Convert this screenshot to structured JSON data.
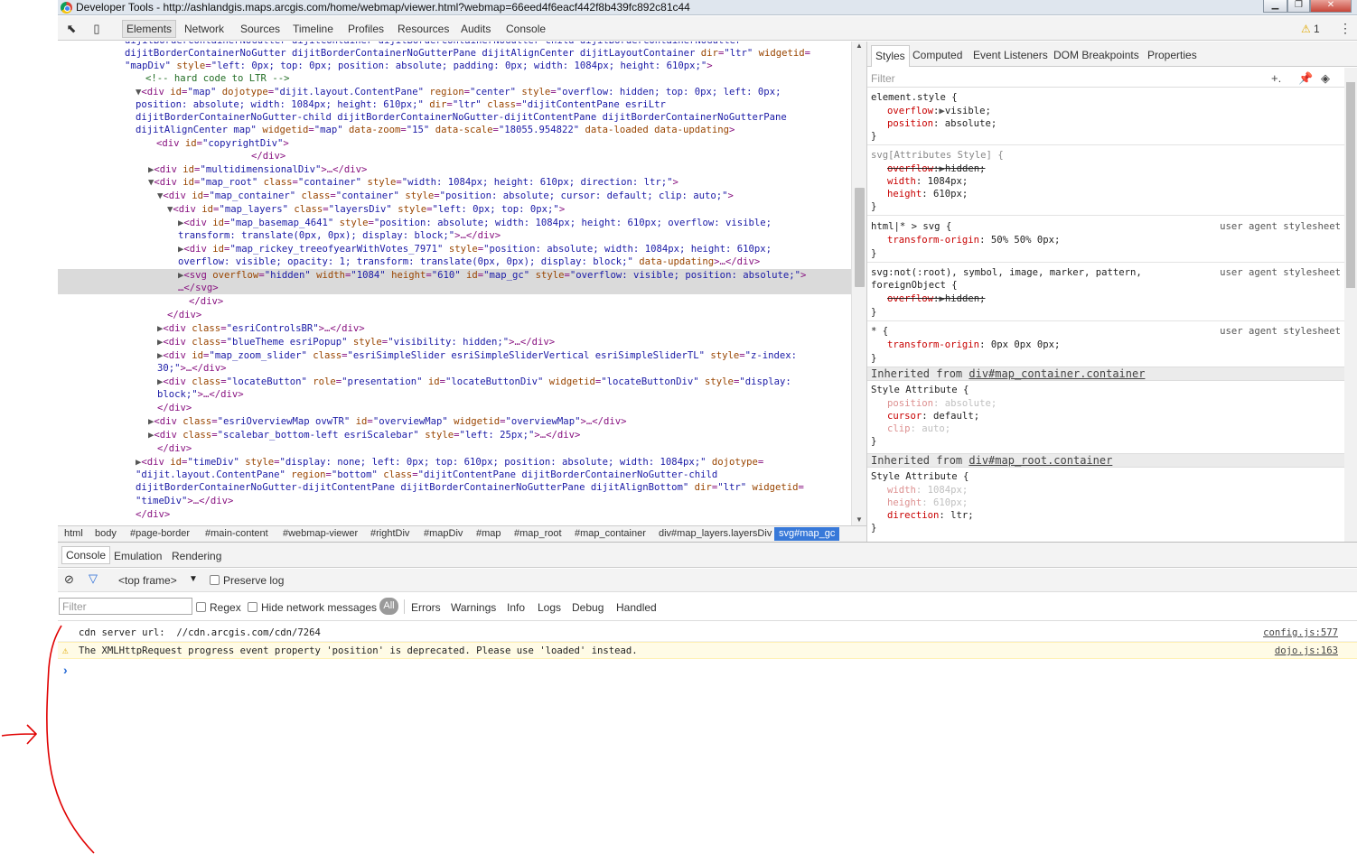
{
  "window": {
    "title": "Developer Tools - http://ashlandgis.maps.arcgis.com/home/webmap/viewer.html?webmap=66eed4f6eacf442f8b439fc892c81c44"
  },
  "toolbar": {
    "tabs": [
      "Elements",
      "Network",
      "Sources",
      "Timeline",
      "Profiles",
      "Resources",
      "Audits",
      "Console"
    ],
    "warning_count": "1"
  },
  "elements_lines": [
    {
      "parts": [
        [
          "av",
          "dijitBorderContainerNoGutter dijitContainer dijitBorderContainerNoGutter-child dijitBorderContainerNoGutter"
        ]
      ]
    },
    {
      "parts": [
        [
          "av",
          "dijitBorderContainerNoGutter dijitBorderContainerNoGutterPane dijitAlignCenter dijitLayoutContainer"
        ],
        [
          "an",
          " dir"
        ],
        [
          "tag",
          "="
        ],
        [
          "av",
          "\"ltr\""
        ],
        [
          "an",
          " widgetid"
        ],
        [
          "tag",
          "="
        ]
      ]
    },
    {
      "parts": [
        [
          "av",
          "\"mapDiv\""
        ],
        [
          "an",
          " style"
        ],
        [
          "tag",
          "="
        ],
        [
          "av",
          "\"left: 0px; top: 0px; position: absolute; padding: 0px; width: 1084px; height: 610px;\""
        ],
        [
          "tag",
          ">"
        ]
      ]
    },
    {
      "parts": [
        [
          "cm",
          "<!-- hard code to LTR -->"
        ]
      ]
    },
    {
      "parts": [
        [
          "tri",
          "▼"
        ],
        [
          "tag",
          "<div"
        ],
        [
          "an",
          " id"
        ],
        [
          "tag",
          "="
        ],
        [
          "av",
          "\"map\""
        ],
        [
          "an",
          " dojotype"
        ],
        [
          "tag",
          "="
        ],
        [
          "av",
          "\"dijit.layout.ContentPane\""
        ],
        [
          "an",
          " region"
        ],
        [
          "tag",
          "="
        ],
        [
          "av",
          "\"center\""
        ],
        [
          "an",
          " style"
        ],
        [
          "tag",
          "="
        ],
        [
          "av",
          "\"overflow: hidden; top: 0px; left: 0px;"
        ]
      ]
    },
    {
      "parts": [
        [
          "av",
          "position: absolute; width: 1084px; height: 610px;\""
        ],
        [
          "an",
          " dir"
        ],
        [
          "tag",
          "="
        ],
        [
          "av",
          "\"ltr\""
        ],
        [
          "an",
          " class"
        ],
        [
          "tag",
          "="
        ],
        [
          "av",
          "\"dijitContentPane esriLtr"
        ]
      ]
    },
    {
      "parts": [
        [
          "av",
          "dijitBorderContainerNoGutter-child dijitBorderContainerNoGutter-dijitContentPane dijitBorderContainerNoGutterPane"
        ]
      ]
    },
    {
      "parts": [
        [
          "av",
          "dijitAlignCenter map\""
        ],
        [
          "an",
          " widgetid"
        ],
        [
          "tag",
          "="
        ],
        [
          "av",
          "\"map\""
        ],
        [
          "an",
          " data-zoom"
        ],
        [
          "tag",
          "="
        ],
        [
          "av",
          "\"15\""
        ],
        [
          "an",
          " data-scale"
        ],
        [
          "tag",
          "="
        ],
        [
          "av",
          "\"18055.954822\""
        ],
        [
          "an",
          " data-loaded data-updating"
        ],
        [
          "tag",
          ">"
        ]
      ]
    },
    {
      "parts": [
        [
          "tag",
          "<div"
        ],
        [
          "an",
          " id"
        ],
        [
          "tag",
          "="
        ],
        [
          "av",
          "\"copyrightDiv\""
        ],
        [
          "tag",
          ">"
        ]
      ]
    },
    {
      "parts": [
        [
          "tag",
          "</div>"
        ]
      ]
    },
    {
      "parts": [
        [
          "tri",
          "▶"
        ],
        [
          "tag",
          "<div"
        ],
        [
          "an",
          " id"
        ],
        [
          "tag",
          "="
        ],
        [
          "av",
          "\"multidimensionalDiv\""
        ],
        [
          "tag",
          ">…</div>"
        ]
      ]
    },
    {
      "parts": [
        [
          "tri",
          "▼"
        ],
        [
          "tag",
          "<div"
        ],
        [
          "an",
          " id"
        ],
        [
          "tag",
          "="
        ],
        [
          "av",
          "\"map_root\""
        ],
        [
          "an",
          " class"
        ],
        [
          "tag",
          "="
        ],
        [
          "av",
          "\"container\""
        ],
        [
          "an",
          " style"
        ],
        [
          "tag",
          "="
        ],
        [
          "av",
          "\"width: 1084px; height: 610px; direction: ltr;\""
        ],
        [
          "tag",
          ">"
        ]
      ]
    },
    {
      "parts": [
        [
          "tri",
          "▼"
        ],
        [
          "tag",
          "<div"
        ],
        [
          "an",
          " id"
        ],
        [
          "tag",
          "="
        ],
        [
          "av",
          "\"map_container\""
        ],
        [
          "an",
          " class"
        ],
        [
          "tag",
          "="
        ],
        [
          "av",
          "\"container\""
        ],
        [
          "an",
          " style"
        ],
        [
          "tag",
          "="
        ],
        [
          "av",
          "\"position: absolute; cursor: default; clip: auto;\""
        ],
        [
          "tag",
          ">"
        ]
      ]
    },
    {
      "parts": [
        [
          "tri",
          "▼"
        ],
        [
          "tag",
          "<div"
        ],
        [
          "an",
          " id"
        ],
        [
          "tag",
          "="
        ],
        [
          "av",
          "\"map_layers\""
        ],
        [
          "an",
          " class"
        ],
        [
          "tag",
          "="
        ],
        [
          "av",
          "\"layersDiv\""
        ],
        [
          "an",
          " style"
        ],
        [
          "tag",
          "="
        ],
        [
          "av",
          "\"left: 0px; top: 0px;\""
        ],
        [
          "tag",
          ">"
        ]
      ]
    },
    {
      "parts": [
        [
          "tri",
          "▶"
        ],
        [
          "tag",
          "<div"
        ],
        [
          "an",
          " id"
        ],
        [
          "tag",
          "="
        ],
        [
          "av",
          "\"map_basemap_4641\""
        ],
        [
          "an",
          " style"
        ],
        [
          "tag",
          "="
        ],
        [
          "av",
          "\"position: absolute; width: 1084px; height: 610px; overflow: visible;"
        ]
      ]
    },
    {
      "parts": [
        [
          "av",
          "transform: translate(0px, 0px); display: block;\""
        ],
        [
          "tag",
          ">…</div>"
        ]
      ]
    },
    {
      "parts": [
        [
          "tri",
          "▶"
        ],
        [
          "tag",
          "<div"
        ],
        [
          "an",
          " id"
        ],
        [
          "tag",
          "="
        ],
        [
          "av",
          "\"map_rickey_treeofyearWithVotes_7971\""
        ],
        [
          "an",
          " style"
        ],
        [
          "tag",
          "="
        ],
        [
          "av",
          "\"position: absolute; width: 1084px; height: 610px;"
        ]
      ]
    },
    {
      "parts": [
        [
          "av",
          "overflow: visible; opacity: 1; transform: translate(0px, 0px); display: block;\""
        ],
        [
          "an",
          " data-updating"
        ],
        [
          "tag",
          ">…</div>"
        ]
      ]
    },
    {
      "parts": [
        [
          "tri",
          "▶"
        ],
        [
          "tag",
          "<svg"
        ],
        [
          "an",
          " overflow"
        ],
        [
          "tag",
          "="
        ],
        [
          "av",
          "\"hidden\""
        ],
        [
          "an",
          " width"
        ],
        [
          "tag",
          "="
        ],
        [
          "av",
          "\"1084\""
        ],
        [
          "an",
          " height"
        ],
        [
          "tag",
          "="
        ],
        [
          "av",
          "\"610\""
        ],
        [
          "an",
          " id"
        ],
        [
          "tag",
          "="
        ],
        [
          "av",
          "\"map_gc\""
        ],
        [
          "an",
          " style"
        ],
        [
          "tag",
          "="
        ],
        [
          "av",
          "\"overflow: visible; position: absolute;\""
        ],
        [
          "tag",
          ">"
        ]
      ]
    },
    {
      "parts": [
        [
          "tag",
          "…</svg>"
        ]
      ]
    },
    {
      "parts": [
        [
          "tag",
          "</div>"
        ]
      ]
    },
    {
      "parts": [
        [
          "tag",
          "</div>"
        ]
      ]
    },
    {
      "parts": [
        [
          "tri",
          "▶"
        ],
        [
          "tag",
          "<div"
        ],
        [
          "an",
          " class"
        ],
        [
          "tag",
          "="
        ],
        [
          "av",
          "\"esriControlsBR\""
        ],
        [
          "tag",
          ">…</div>"
        ]
      ]
    },
    {
      "parts": [
        [
          "tri",
          "▶"
        ],
        [
          "tag",
          "<div"
        ],
        [
          "an",
          " class"
        ],
        [
          "tag",
          "="
        ],
        [
          "av",
          "\"blueTheme esriPopup\""
        ],
        [
          "an",
          " style"
        ],
        [
          "tag",
          "="
        ],
        [
          "av",
          "\"visibility: hidden;\""
        ],
        [
          "tag",
          ">…</div>"
        ]
      ]
    },
    {
      "parts": [
        [
          "tri",
          "▶"
        ],
        [
          "tag",
          "<div"
        ],
        [
          "an",
          " id"
        ],
        [
          "tag",
          "="
        ],
        [
          "av",
          "\"map_zoom_slider\""
        ],
        [
          "an",
          " class"
        ],
        [
          "tag",
          "="
        ],
        [
          "av",
          "\"esriSimpleSlider esriSimpleSliderVertical esriSimpleSliderTL\""
        ],
        [
          "an",
          " style"
        ],
        [
          "tag",
          "="
        ],
        [
          "av",
          "\"z-index:"
        ]
      ]
    },
    {
      "parts": [
        [
          "av",
          "30;\""
        ],
        [
          "tag",
          ">…</div>"
        ]
      ]
    },
    {
      "parts": [
        [
          "tri",
          "▶"
        ],
        [
          "tag",
          "<div"
        ],
        [
          "an",
          " class"
        ],
        [
          "tag",
          "="
        ],
        [
          "av",
          "\"locateButton\""
        ],
        [
          "an",
          " role"
        ],
        [
          "tag",
          "="
        ],
        [
          "av",
          "\"presentation\""
        ],
        [
          "an",
          " id"
        ],
        [
          "tag",
          "="
        ],
        [
          "av",
          "\"locateButtonDiv\""
        ],
        [
          "an",
          " widgetid"
        ],
        [
          "tag",
          "="
        ],
        [
          "av",
          "\"locateButtonDiv\""
        ],
        [
          "an",
          " style"
        ],
        [
          "tag",
          "="
        ],
        [
          "av",
          "\"display:"
        ]
      ]
    },
    {
      "parts": [
        [
          "av",
          "block;\""
        ],
        [
          "tag",
          ">…</div>"
        ]
      ]
    },
    {
      "parts": [
        [
          "tag",
          "</div>"
        ]
      ]
    },
    {
      "parts": [
        [
          "tri",
          "▶"
        ],
        [
          "tag",
          "<div"
        ],
        [
          "an",
          " class"
        ],
        [
          "tag",
          "="
        ],
        [
          "av",
          "\"esriOverviewMap ovwTR\""
        ],
        [
          "an",
          " id"
        ],
        [
          "tag",
          "="
        ],
        [
          "av",
          "\"overviewMap\""
        ],
        [
          "an",
          " widgetid"
        ],
        [
          "tag",
          "="
        ],
        [
          "av",
          "\"overviewMap\""
        ],
        [
          "tag",
          ">…</div>"
        ]
      ]
    },
    {
      "parts": [
        [
          "tri",
          "▶"
        ],
        [
          "tag",
          "<div"
        ],
        [
          "an",
          " class"
        ],
        [
          "tag",
          "="
        ],
        [
          "av",
          "\"scalebar_bottom-left esriScalebar\""
        ],
        [
          "an",
          " style"
        ],
        [
          "tag",
          "="
        ],
        [
          "av",
          "\"left: 25px;\""
        ],
        [
          "tag",
          ">…</div>"
        ]
      ]
    },
    {
      "parts": [
        [
          "tag",
          "</div>"
        ]
      ]
    },
    {
      "parts": [
        [
          "tri",
          "▶"
        ],
        [
          "tag",
          "<div"
        ],
        [
          "an",
          " id"
        ],
        [
          "tag",
          "="
        ],
        [
          "av",
          "\"timeDiv\""
        ],
        [
          "an",
          " style"
        ],
        [
          "tag",
          "="
        ],
        [
          "av",
          "\"display: none; left: 0px; top: 610px; position: absolute; width: 1084px;\""
        ],
        [
          "an",
          " dojotype"
        ],
        [
          "tag",
          "="
        ]
      ]
    },
    {
      "parts": [
        [
          "av",
          "\"dijit.layout.ContentPane\""
        ],
        [
          "an",
          " region"
        ],
        [
          "tag",
          "="
        ],
        [
          "av",
          "\"bottom\""
        ],
        [
          "an",
          " class"
        ],
        [
          "tag",
          "="
        ],
        [
          "av",
          "\"dijitContentPane dijitBorderContainerNoGutter-child"
        ]
      ]
    },
    {
      "parts": [
        [
          "av",
          "dijitBorderContainerNoGutter-dijitContentPane dijitBorderContainerNoGutterPane dijitAlignBottom\""
        ],
        [
          "an",
          " dir"
        ],
        [
          "tag",
          "="
        ],
        [
          "av",
          "\"ltr\""
        ],
        [
          "an",
          " widgetid"
        ],
        [
          "tag",
          "="
        ]
      ]
    },
    {
      "parts": [
        [
          "av",
          "\"timeDiv\""
        ],
        [
          "tag",
          ">…</div>"
        ]
      ]
    },
    {
      "parts": [
        [
          "tag",
          "</div>"
        ]
      ]
    }
  ],
  "breadcrumbs": [
    "html",
    "body",
    "#page-border",
    "#main-content",
    "#webmap-viewer",
    "#rightDiv",
    "#mapDiv",
    "#map",
    "#map_root",
    "#map_container",
    "div#map_layers.layersDiv",
    "svg#map_gc"
  ],
  "sidebar": {
    "tabs": [
      "Styles",
      "Computed",
      "Event Listeners",
      "DOM Breakpoints",
      "Properties"
    ],
    "filter_placeholder": "Filter",
    "rules": {
      "r1_sel": "element.style {",
      "r1_p1": "overflow",
      "r1_v1": "visible;",
      "r1_p2": "position",
      "r1_v2": "absolute;",
      "r2_sel": "svg[Attributes Style] {",
      "r2_p1": "overflow",
      "r2_v1": "hidden;",
      "r2_p2": "width",
      "r2_v2": "1084px;",
      "r2_p3": "height",
      "r2_v3": "610px;",
      "r3_sel": "html|* > svg {",
      "r3_p1": "transform-origin",
      "r3_v1": "50% 50% 0px;",
      "r4_sel_a": "svg:not(:root), symbol, image, marker, pattern,",
      "r4_sel_b": "foreignObject {",
      "r4_p1": "overflow",
      "r4_v1": "hidden;",
      "r5_sel": "* {",
      "r5_p1": "transform-origin",
      "r5_v1": "0px 0px 0px;",
      "ua": "user agent stylesheet",
      "close": "}",
      "inh1_prefix": "Inherited from ",
      "inh1_link": "div#map_container.container",
      "inh2_prefix": "Inherited from ",
      "inh2_link": "div#map_root.container",
      "sa": "Style Attribute {",
      "i1_p1": "position",
      "i1_v1": "absolute;",
      "i1_p2": "cursor",
      "i1_v2": "default;",
      "i1_p3": "clip",
      "i1_v3": "auto;",
      "i2_p1": "width",
      "i2_v1": "1084px;",
      "i2_p2": "height",
      "i2_v2": "610px;",
      "i2_p3": "direction",
      "i2_v3": "ltr;"
    }
  },
  "drawer": {
    "tabs": [
      "Console",
      "Emulation",
      "Rendering"
    ],
    "frame": "<top frame>",
    "preserve_log": "Preserve log",
    "filter_placeholder": "Filter",
    "regex": "Regex",
    "hide_network": "Hide network messages",
    "levels": [
      "All",
      "Errors",
      "Warnings",
      "Info",
      "Logs",
      "Debug",
      "Handled"
    ],
    "messages": [
      {
        "text": "cdn server url:  //cdn.arcgis.com/cdn/7264",
        "source": "config.js:577",
        "level": "log"
      },
      {
        "text": "The XMLHttpRequest progress event property 'position' is deprecated. Please use 'loaded' instead.",
        "source": "dojo.js:163",
        "level": "warning"
      }
    ],
    "prompt": "›"
  },
  "colors": {
    "selected_breadcrumb": "#3879d9",
    "annotation": "#e00000",
    "warning_bg": "#fffbe6"
  }
}
